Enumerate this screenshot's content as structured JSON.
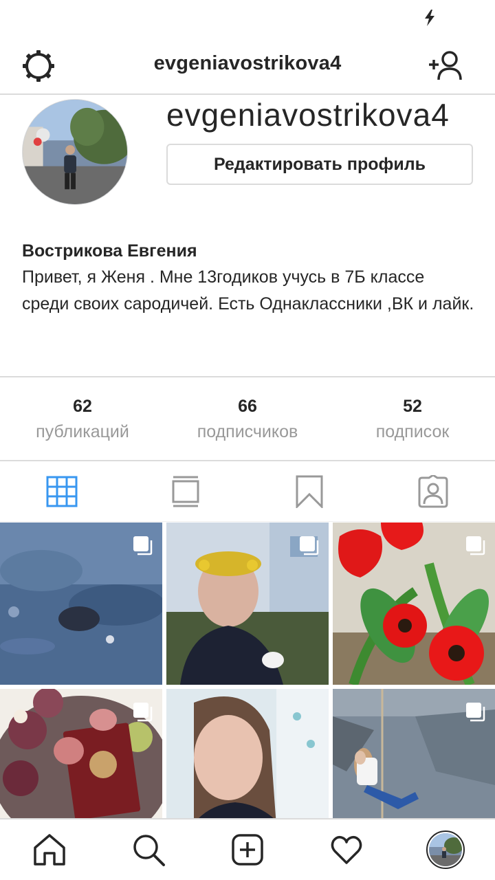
{
  "header": {
    "username": "evgeniavostrikova4"
  },
  "profile": {
    "display_name_big": "evgeniavostrikova4",
    "edit_button": "Редактировать профиль",
    "full_name": "Вострикова Евгения",
    "bio": "Привет, я Женя . Мне 13годиков учусь в 7Б классе среди своих сародичей. Есть Однаклассники ,ВК и лайк."
  },
  "stats": [
    {
      "value": "62",
      "label": "публикаций"
    },
    {
      "value": "66",
      "label": "подписчиков"
    },
    {
      "value": "52",
      "label": "подписок"
    }
  ],
  "tabs": [
    {
      "icon": "grid-icon",
      "active": true
    },
    {
      "icon": "feed-icon",
      "active": false
    },
    {
      "icon": "bookmark-icon",
      "active": false
    },
    {
      "icon": "tagged-icon",
      "active": false
    }
  ],
  "posts": [
    {
      "description": "dark blue water with stones",
      "multi": true
    },
    {
      "description": "girl with dandelion crown",
      "multi": true
    },
    {
      "description": "red tulips",
      "multi": true
    },
    {
      "description": "cake with passport",
      "multi": true
    },
    {
      "description": "girl selfie",
      "multi": false
    },
    {
      "description": "girl on rope swing",
      "multi": true
    }
  ],
  "bottom_nav": [
    {
      "icon": "home-icon"
    },
    {
      "icon": "search-icon"
    },
    {
      "icon": "add-post-icon"
    },
    {
      "icon": "heart-icon"
    },
    {
      "icon": "profile-avatar-icon"
    }
  ],
  "colors": {
    "accent": "#3897f0",
    "border": "#dbdbdb",
    "text": "#262626",
    "muted": "#999999"
  }
}
